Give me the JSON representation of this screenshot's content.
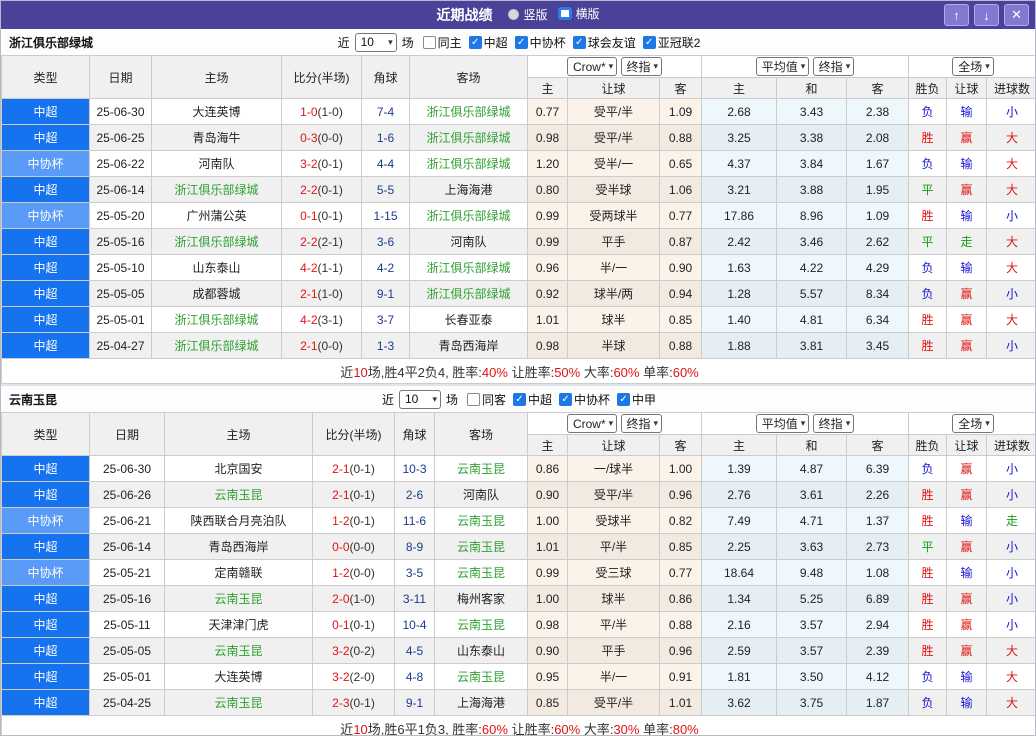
{
  "title_bar": {
    "title": "近期战绩",
    "radios": [
      {
        "label": "竖版",
        "selected": false
      },
      {
        "label": "横版",
        "selected": true
      }
    ],
    "buttons": {
      "up": "↑",
      "down": "↓",
      "close": "✕"
    }
  },
  "headers": {
    "type": "类型",
    "date": "日期",
    "home": "主场",
    "score": "比分(半场)",
    "corners": "角球",
    "away": "客场",
    "crow_select": "Crow*",
    "crow_index": "终指",
    "avg_select": "平均值",
    "avg_index": "终指",
    "scope_select": "全场",
    "sub": {
      "home": "主",
      "handicap": "让球",
      "away": "客",
      "avg_home": "主",
      "avg_draw": "和",
      "avg_away": "客",
      "wl": "胜负",
      "handicap_result": "让球",
      "goals": "进球数"
    }
  },
  "colors": {
    "titlebar": "#4a4198",
    "league": {
      "中超": "#1673f0",
      "中协杯": "#5b9bf8"
    },
    "focal_team": "#2fa030",
    "score_red": "#e01414",
    "result_red": "#e01414",
    "result_blue": "#1414d2",
    "result_green": "#11a011",
    "checkbox_blue": "#1d78e6"
  },
  "sections": [
    {
      "team": "浙江俱乐部绿城",
      "filter": {
        "near": "近",
        "count": "10",
        "games": "场",
        "checkboxes": [
          {
            "label": "同主",
            "checked": false
          },
          {
            "label": "中超",
            "checked": true
          },
          {
            "label": "中协杯",
            "checked": true
          },
          {
            "label": "球会友谊",
            "checked": true
          },
          {
            "label": "亚冠联2",
            "checked": true
          }
        ]
      },
      "rows": [
        [
          "中超",
          "25-06-30",
          "大连英博",
          "1-0",
          "(1-0)",
          "7-4",
          "浙江俱乐部绿城",
          "0.77",
          "受平/半",
          "1.09",
          "2.68",
          "3.43",
          "2.38",
          "负",
          "输",
          "小"
        ],
        [
          "中超",
          "25-06-25",
          "青岛海牛",
          "0-3",
          "(0-0)",
          "1-6",
          "浙江俱乐部绿城",
          "0.98",
          "受平/半",
          "0.88",
          "3.25",
          "3.38",
          "2.08",
          "胜",
          "赢",
          "大"
        ],
        [
          "中协杯",
          "25-06-22",
          "河南队",
          "3-2",
          "(0-1)",
          "4-4",
          "浙江俱乐部绿城",
          "1.20",
          "受半/一",
          "0.65",
          "4.37",
          "3.84",
          "1.67",
          "负",
          "输",
          "大"
        ],
        [
          "中超",
          "25-06-14",
          "浙江俱乐部绿城",
          "2-2",
          "(0-1)",
          "5-5",
          "上海海港",
          "0.80",
          "受半球",
          "1.06",
          "3.21",
          "3.88",
          "1.95",
          "平",
          "赢",
          "大"
        ],
        [
          "中协杯",
          "25-05-20",
          "广州蒲公英",
          "0-1",
          "(0-1)",
          "1-15",
          "浙江俱乐部绿城",
          "0.99",
          "受两球半",
          "0.77",
          "17.86",
          "8.96",
          "1.09",
          "胜",
          "输",
          "小"
        ],
        [
          "中超",
          "25-05-16",
          "浙江俱乐部绿城",
          "2-2",
          "(2-1)",
          "3-6",
          "河南队",
          "0.99",
          "平手",
          "0.87",
          "2.42",
          "3.46",
          "2.62",
          "平",
          "走",
          "大"
        ],
        [
          "中超",
          "25-05-10",
          "山东泰山",
          "4-2",
          "(1-1)",
          "4-2",
          "浙江俱乐部绿城",
          "0.96",
          "半/一",
          "0.90",
          "1.63",
          "4.22",
          "4.29",
          "负",
          "输",
          "大"
        ],
        [
          "中超",
          "25-05-05",
          "成都蓉城",
          "2-1",
          "(1-0)",
          "9-1",
          "浙江俱乐部绿城",
          "0.92",
          "球半/两",
          "0.94",
          "1.28",
          "5.57",
          "8.34",
          "负",
          "赢",
          "小"
        ],
        [
          "中超",
          "25-05-01",
          "浙江俱乐部绿城",
          "4-2",
          "(3-1)",
          "3-7",
          "长春亚泰",
          "1.01",
          "球半",
          "0.85",
          "1.40",
          "4.81",
          "6.34",
          "胜",
          "赢",
          "大"
        ],
        [
          "中超",
          "25-04-27",
          "浙江俱乐部绿城",
          "2-1",
          "(0-0)",
          "1-3",
          "青岛西海岸",
          "0.98",
          "半球",
          "0.88",
          "1.88",
          "3.81",
          "3.45",
          "胜",
          "赢",
          "小"
        ]
      ],
      "summary": [
        {
          "text": "近",
          "red": false
        },
        {
          "text": "10",
          "red": true
        },
        {
          "text": "场,胜4平2负4, 胜率:",
          "red": false
        },
        {
          "text": "40%",
          "red": true
        },
        {
          "text": " 让胜率:",
          "red": false
        },
        {
          "text": "50%",
          "red": true
        },
        {
          "text": " 大率:",
          "red": false
        },
        {
          "text": "60%",
          "red": true
        },
        {
          "text": " 单率:",
          "red": false
        },
        {
          "text": "60%",
          "red": true
        }
      ]
    },
    {
      "team": "云南玉昆",
      "filter": {
        "near": "近",
        "count": "10",
        "games": "场",
        "checkboxes": [
          {
            "label": "同客",
            "checked": false
          },
          {
            "label": "中超",
            "checked": true
          },
          {
            "label": "中协杯",
            "checked": true
          },
          {
            "label": "中甲",
            "checked": true
          }
        ]
      },
      "rows": [
        [
          "中超",
          "25-06-30",
          "北京国安",
          "2-1",
          "(0-1)",
          "10-3",
          "云南玉昆",
          "0.86",
          "一/球半",
          "1.00",
          "1.39",
          "4.87",
          "6.39",
          "负",
          "赢",
          "小"
        ],
        [
          "中超",
          "25-06-26",
          "云南玉昆",
          "2-1",
          "(0-1)",
          "2-6",
          "河南队",
          "0.90",
          "受平/半",
          "0.96",
          "2.76",
          "3.61",
          "2.26",
          "胜",
          "赢",
          "小"
        ],
        [
          "中协杯",
          "25-06-21",
          "陕西联合月亮泊队",
          "1-2",
          "(0-1)",
          "11-6",
          "云南玉昆",
          "1.00",
          "受球半",
          "0.82",
          "7.49",
          "4.71",
          "1.37",
          "胜",
          "输",
          "走"
        ],
        [
          "中超",
          "25-06-14",
          "青岛西海岸",
          "0-0",
          "(0-0)",
          "8-9",
          "云南玉昆",
          "1.01",
          "平/半",
          "0.85",
          "2.25",
          "3.63",
          "2.73",
          "平",
          "赢",
          "小"
        ],
        [
          "中协杯",
          "25-05-21",
          "定南赣联",
          "1-2",
          "(0-0)",
          "3-5",
          "云南玉昆",
          "0.99",
          "受三球",
          "0.77",
          "18.64",
          "9.48",
          "1.08",
          "胜",
          "输",
          "小"
        ],
        [
          "中超",
          "25-05-16",
          "云南玉昆",
          "2-0",
          "(1-0)",
          "3-11",
          "梅州客家",
          "1.00",
          "球半",
          "0.86",
          "1.34",
          "5.25",
          "6.89",
          "胜",
          "赢",
          "小"
        ],
        [
          "中超",
          "25-05-11",
          "天津津门虎",
          "0-1",
          "(0-1)",
          "10-4",
          "云南玉昆",
          "0.98",
          "平/半",
          "0.88",
          "2.16",
          "3.57",
          "2.94",
          "胜",
          "赢",
          "小"
        ],
        [
          "中超",
          "25-05-05",
          "云南玉昆",
          "3-2",
          "(0-2)",
          "4-5",
          "山东泰山",
          "0.90",
          "平手",
          "0.96",
          "2.59",
          "3.57",
          "2.39",
          "胜",
          "赢",
          "大"
        ],
        [
          "中超",
          "25-05-01",
          "大连英博",
          "3-2",
          "(2-0)",
          "4-8",
          "云南玉昆",
          "0.95",
          "半/一",
          "0.91",
          "1.81",
          "3.50",
          "4.12",
          "负",
          "输",
          "大"
        ],
        [
          "中超",
          "25-04-25",
          "云南玉昆",
          "2-3",
          "(0-1)",
          "9-1",
          "上海海港",
          "0.85",
          "受平/半",
          "1.01",
          "3.62",
          "3.75",
          "1.87",
          "负",
          "输",
          "大"
        ]
      ],
      "summary": [
        {
          "text": "近",
          "red": false
        },
        {
          "text": "10",
          "red": true
        },
        {
          "text": "场,胜6平1负3, 胜率:",
          "red": false
        },
        {
          "text": "60%",
          "red": true
        },
        {
          "text": " 让胜率:",
          "red": false
        },
        {
          "text": "60%",
          "red": true
        },
        {
          "text": " 大率:",
          "red": false
        },
        {
          "text": "30%",
          "red": true
        },
        {
          "text": " 单率:",
          "red": false
        },
        {
          "text": "80%",
          "red": true
        }
      ]
    }
  ]
}
